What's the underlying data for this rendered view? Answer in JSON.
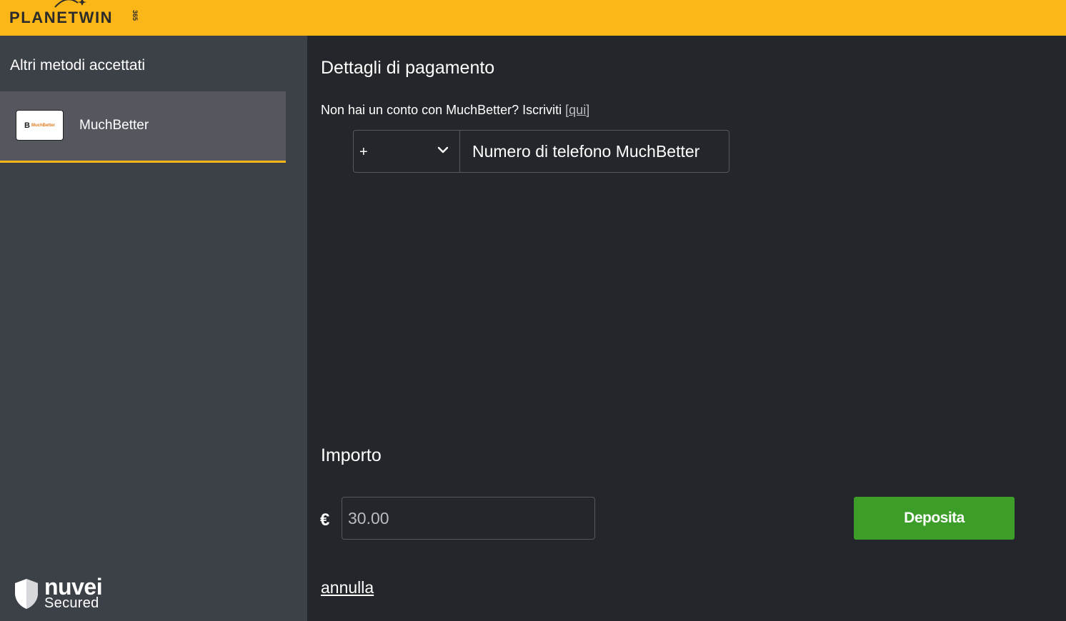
{
  "header": {
    "logo_text": "PLANETWIN",
    "logo_suffix": "365",
    "brand_color": "#fbb617"
  },
  "sidebar": {
    "title": "Altri metodi accettati",
    "methods": [
      {
        "label": "MuchBetter",
        "logo_text": "MuchBetter",
        "logo_mark": "B",
        "selected": true
      }
    ],
    "footer": {
      "brand": "nuvei",
      "tagline": "Secured",
      "icon": "shield-icon"
    }
  },
  "payment": {
    "title": "Dettagli di pagamento",
    "signup_text": "Non hai un conto con MuchBetter? Iscriviti ",
    "signup_link": "[qui]",
    "phone_prefix": "+",
    "phone_placeholder": "Numero di telefono MuchBetter"
  },
  "amount": {
    "title": "Importo",
    "currency": "€",
    "value": "30.00"
  },
  "actions": {
    "deposit_label": "Deposita",
    "deposit_color": "#3c9e28",
    "cancel_label": "annulla"
  }
}
